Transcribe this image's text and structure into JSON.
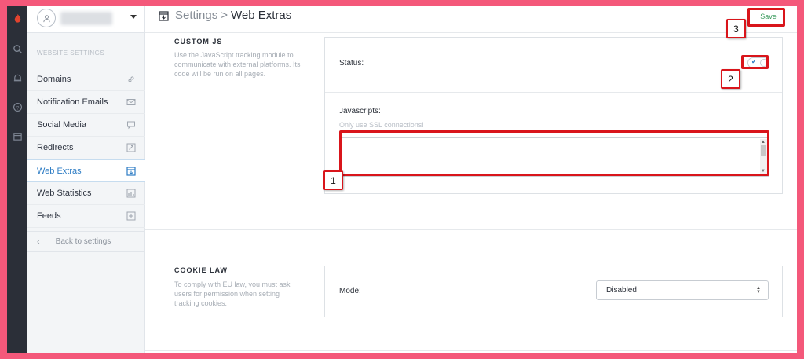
{
  "rail": {
    "icons": [
      "flame-logo-icon",
      "search-icon",
      "bell-icon",
      "help-icon",
      "calendar-icon"
    ]
  },
  "sidebar": {
    "heading": "WEBSITE SETTINGS",
    "items": [
      {
        "label": "Domains",
        "icon": "link-icon",
        "active": false
      },
      {
        "label": "Notification Emails",
        "icon": "email-icon",
        "active": false
      },
      {
        "label": "Social Media",
        "icon": "chat-icon",
        "active": false
      },
      {
        "label": "Redirects",
        "icon": "redirect-icon",
        "active": false
      },
      {
        "label": "Web Extras",
        "icon": "extras-icon",
        "active": true
      },
      {
        "label": "Web Statistics",
        "icon": "statistics-icon",
        "active": false
      },
      {
        "label": "Feeds",
        "icon": "feeds-icon",
        "active": false
      }
    ],
    "back_label": "Back to settings"
  },
  "header": {
    "breadcrumb_parent": "Settings",
    "breadcrumb_separator": ">",
    "breadcrumb_current": "Web Extras",
    "save_label": "Save"
  },
  "custom_js": {
    "title": "CUSTOM JS",
    "description": "Use the JavaScript tracking module to communicate with external platforms. Its code will be run on all pages.",
    "status_label": "Status:",
    "status_enabled": true,
    "javascripts_label": "Javascripts:",
    "javascripts_hint": "Only use SSL connections!",
    "javascripts_value": ""
  },
  "cookie_law": {
    "title": "COOKIE LAW",
    "description": "To comply with EU law, you must ask users for permission when setting tracking cookies.",
    "mode_label": "Mode:",
    "mode_value": "Disabled"
  },
  "annotations": {
    "badge_1": "1",
    "badge_2": "2",
    "badge_3": "3"
  },
  "colors": {
    "annotation": "#d9151b",
    "frame": "#f4587a",
    "accent": "#2d7cc4",
    "save": "#3a9a5c"
  }
}
